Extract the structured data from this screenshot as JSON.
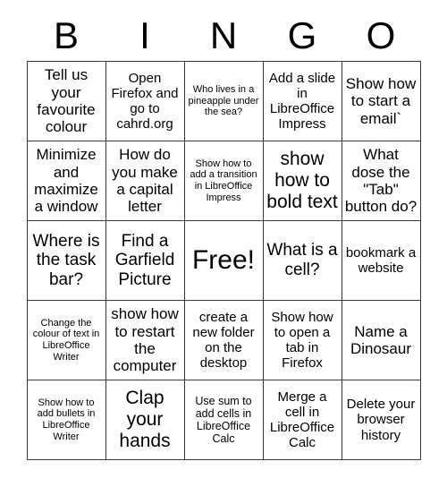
{
  "card": {
    "header_letters": [
      "B",
      "I",
      "N",
      "G",
      "O"
    ],
    "rows": [
      [
        {
          "text": "Tell us your favourite colour",
          "size": "fs-lg"
        },
        {
          "text": "Open Firefox and go to cahrd.org",
          "size": "fs-md"
        },
        {
          "text": "Who lives in a pineapple under the sea?",
          "size": "fs-xs"
        },
        {
          "text": "Add a slide in LibreOffice Impress",
          "size": "fs-md"
        },
        {
          "text": "Show how to start a email`",
          "size": "fs-lg"
        }
      ],
      [
        {
          "text": "Minimize and maximize a window",
          "size": "fs-lg"
        },
        {
          "text": "How do you make a capital letter",
          "size": "fs-lg"
        },
        {
          "text": "Show how to add a transition in LibreOffice Impress",
          "size": "fs-xs"
        },
        {
          "text": "show how to bold text",
          "size": "fs-xxl"
        },
        {
          "text": "What dose the \"Tab\" button do?",
          "size": "fs-lg"
        }
      ],
      [
        {
          "text": "Where is the task bar?",
          "size": "fs-xl"
        },
        {
          "text": "Find a Garfield Picture",
          "size": "fs-xl"
        },
        {
          "text": "Free!",
          "size": "fs-free"
        },
        {
          "text": "What is a cell?",
          "size": "fs-xl"
        },
        {
          "text": "bookmark a website",
          "size": "fs-md"
        }
      ],
      [
        {
          "text": "Change the colour of text in LibreOffice Writer",
          "size": "fs-xs"
        },
        {
          "text": "show how to restart the computer",
          "size": "fs-lg"
        },
        {
          "text": "create a new folder on the desktop",
          "size": "fs-md"
        },
        {
          "text": "Show how to open a tab in Firefox",
          "size": "fs-md"
        },
        {
          "text": "Name a Dinosaur",
          "size": "fs-lg"
        }
      ],
      [
        {
          "text": "Show how to add bullets in LibreOffice Writer",
          "size": "fs-xs"
        },
        {
          "text": "Clap your hands",
          "size": "fs-xxl"
        },
        {
          "text": "Use sum to add cells in LibreOffice Calc",
          "size": "fs-sm"
        },
        {
          "text": "Merge a cell in LibreOffice Calc",
          "size": "fs-md"
        },
        {
          "text": "Delete your browser history",
          "size": "fs-md"
        }
      ]
    ]
  },
  "colors": {
    "background": "#ffffff",
    "text": "#000000",
    "border": "#3a3a3a"
  }
}
